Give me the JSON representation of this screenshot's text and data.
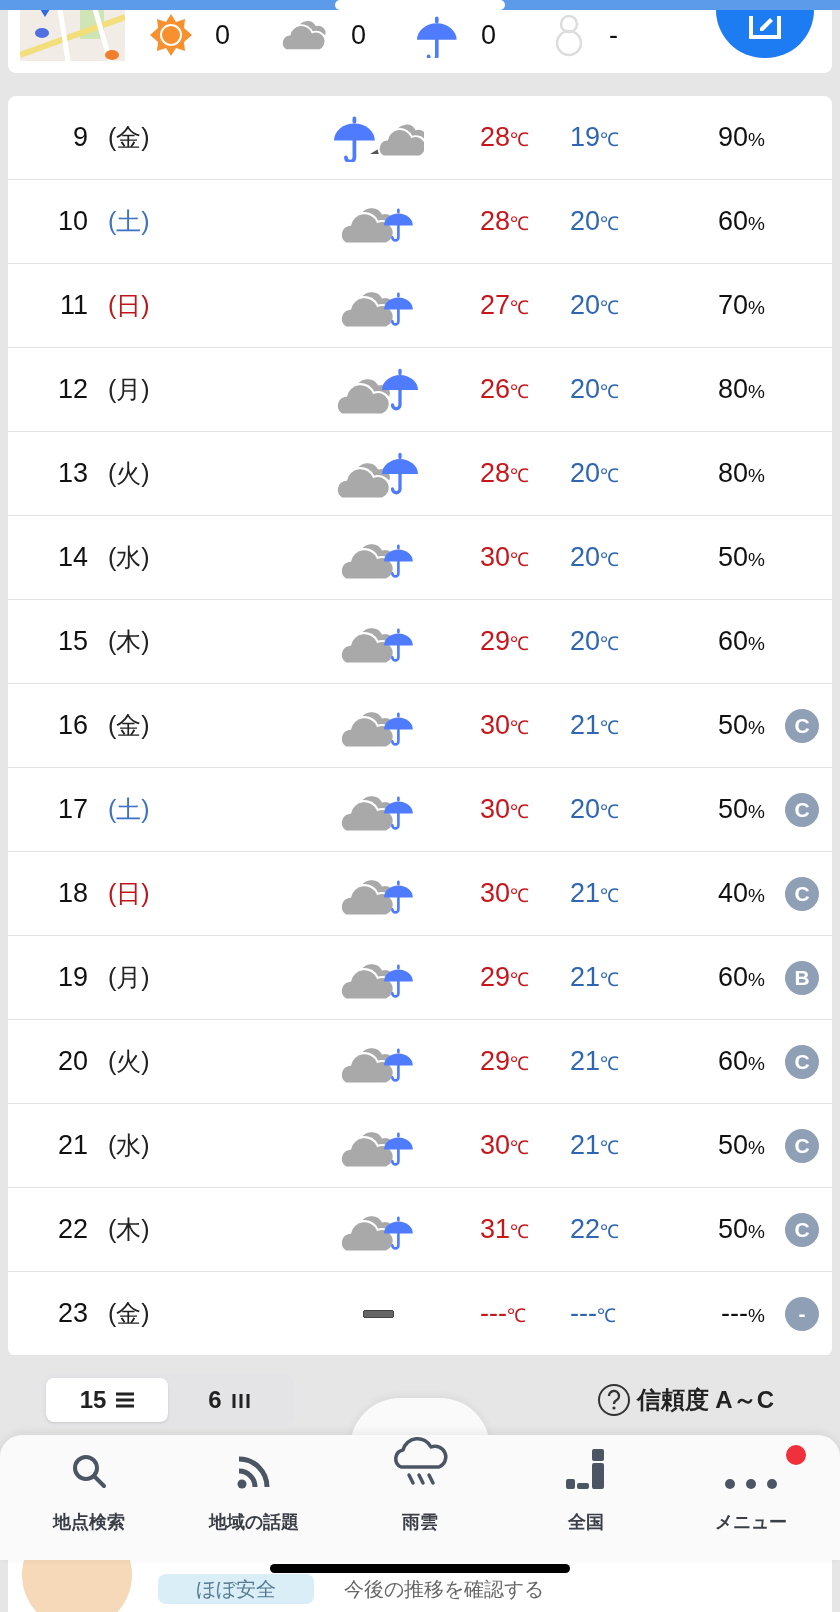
{
  "summary": {
    "stats": [
      {
        "kind": "sun",
        "count": "0"
      },
      {
        "kind": "cloud",
        "count": "0"
      },
      {
        "kind": "rain",
        "count": "0"
      },
      {
        "kind": "snow",
        "count": "-"
      }
    ]
  },
  "forecast": {
    "rows": [
      {
        "date": "9",
        "weekday": "(金)",
        "color": "#222222",
        "kind": "rain_then_cloud",
        "high": "28",
        "high_unit": "℃",
        "low": "19",
        "low_unit": "℃",
        "pop": "90",
        "pop_unit": "%"
      },
      {
        "date": "10",
        "weekday": "(土)",
        "color": "#3d72c4",
        "kind": "cloud_rain",
        "high": "28",
        "high_unit": "℃",
        "low": "20",
        "low_unit": "℃",
        "pop": "60",
        "pop_unit": "%"
      },
      {
        "date": "11",
        "weekday": "(日)",
        "color": "#c0161b",
        "kind": "cloud_rain",
        "high": "27",
        "high_unit": "℃",
        "low": "20",
        "low_unit": "℃",
        "pop": "70",
        "pop_unit": "%"
      },
      {
        "date": "12",
        "weekday": "(月)",
        "color": "#222222",
        "kind": "cloud_heavy_rain",
        "high": "26",
        "high_unit": "℃",
        "low": "20",
        "low_unit": "℃",
        "pop": "80",
        "pop_unit": "%"
      },
      {
        "date": "13",
        "weekday": "(火)",
        "color": "#222222",
        "kind": "cloud_heavy_rain",
        "high": "28",
        "high_unit": "℃",
        "low": "20",
        "low_unit": "℃",
        "pop": "80",
        "pop_unit": "%"
      },
      {
        "date": "14",
        "weekday": "(水)",
        "color": "#222222",
        "kind": "cloud_rain",
        "high": "30",
        "high_unit": "℃",
        "low": "20",
        "low_unit": "℃",
        "pop": "50",
        "pop_unit": "%"
      },
      {
        "date": "15",
        "weekday": "(木)",
        "color": "#222222",
        "kind": "cloud_rain",
        "high": "29",
        "high_unit": "℃",
        "low": "20",
        "low_unit": "℃",
        "pop": "60",
        "pop_unit": "%"
      },
      {
        "date": "16",
        "weekday": "(金)",
        "color": "#222222",
        "kind": "cloud_rain",
        "high": "30",
        "high_unit": "℃",
        "low": "21",
        "low_unit": "℃",
        "pop": "50",
        "pop_unit": "%",
        "reliability": "C"
      },
      {
        "date": "17",
        "weekday": "(土)",
        "color": "#3d72c4",
        "kind": "cloud_rain",
        "high": "30",
        "high_unit": "℃",
        "low": "20",
        "low_unit": "℃",
        "pop": "50",
        "pop_unit": "%",
        "reliability": "C"
      },
      {
        "date": "18",
        "weekday": "(日)",
        "color": "#c0161b",
        "kind": "cloud_rain",
        "high": "30",
        "high_unit": "℃",
        "low": "21",
        "low_unit": "℃",
        "pop": "40",
        "pop_unit": "%",
        "reliability": "C"
      },
      {
        "date": "19",
        "weekday": "(月)",
        "color": "#222222",
        "kind": "cloud_rain",
        "high": "29",
        "high_unit": "℃",
        "low": "21",
        "low_unit": "℃",
        "pop": "60",
        "pop_unit": "%",
        "reliability": "B"
      },
      {
        "date": "20",
        "weekday": "(火)",
        "color": "#222222",
        "kind": "cloud_rain",
        "high": "29",
        "high_unit": "℃",
        "low": "21",
        "low_unit": "℃",
        "pop": "60",
        "pop_unit": "%",
        "reliability": "C"
      },
      {
        "date": "21",
        "weekday": "(水)",
        "color": "#222222",
        "kind": "cloud_rain",
        "high": "30",
        "high_unit": "℃",
        "low": "21",
        "low_unit": "℃",
        "pop": "50",
        "pop_unit": "%",
        "reliability": "C"
      },
      {
        "date": "22",
        "weekday": "(木)",
        "color": "#222222",
        "kind": "cloud_rain",
        "high": "31",
        "high_unit": "℃",
        "low": "22",
        "low_unit": "℃",
        "pop": "50",
        "pop_unit": "%",
        "reliability": "C"
      },
      {
        "date": "23",
        "weekday": "(金)",
        "color": "#222222",
        "kind": "none",
        "high": "---",
        "high_unit": "℃",
        "low": "---",
        "low_unit": "℃",
        "pop": "---",
        "pop_unit": "%",
        "reliability": "-"
      }
    ]
  },
  "view_toggle": [
    {
      "label": "15",
      "kind": "list",
      "selected": true
    },
    {
      "label": "6",
      "kind": "bars",
      "selected": false
    }
  ],
  "reliability_help": "信頼度 A～C",
  "heat_risk": {
    "level": "ほぼ安全",
    "link": "今後の推移を確認する"
  },
  "nav": [
    {
      "kind": "search",
      "label": "地点検索",
      "notification": false
    },
    {
      "kind": "topics",
      "label": "地域の話題",
      "notification": false
    },
    {
      "kind": "rain",
      "label": "雨雲",
      "notification": false
    },
    {
      "kind": "national",
      "label": "全国",
      "notification": false
    },
    {
      "kind": "menu",
      "label": "メニュー",
      "notification": true
    }
  ]
}
